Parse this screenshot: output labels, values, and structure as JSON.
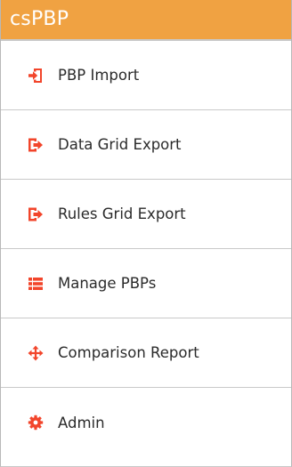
{
  "header": {
    "title": "csPBP"
  },
  "menu": {
    "items": [
      {
        "label": "PBP Import",
        "icon": "sign-in-icon"
      },
      {
        "label": "Data Grid Export",
        "icon": "sign-out-icon"
      },
      {
        "label": "Rules Grid Export",
        "icon": "sign-out-icon"
      },
      {
        "label": "Manage PBPs",
        "icon": "list-icon"
      },
      {
        "label": "Comparison Report",
        "icon": "arrows-move-icon"
      },
      {
        "label": "Admin",
        "icon": "gear-icon"
      }
    ]
  },
  "colors": {
    "header_bg": "#f0a242",
    "icon_red": "#f2452b",
    "text": "#2b2b2b",
    "divider": "#c9c9c9"
  }
}
